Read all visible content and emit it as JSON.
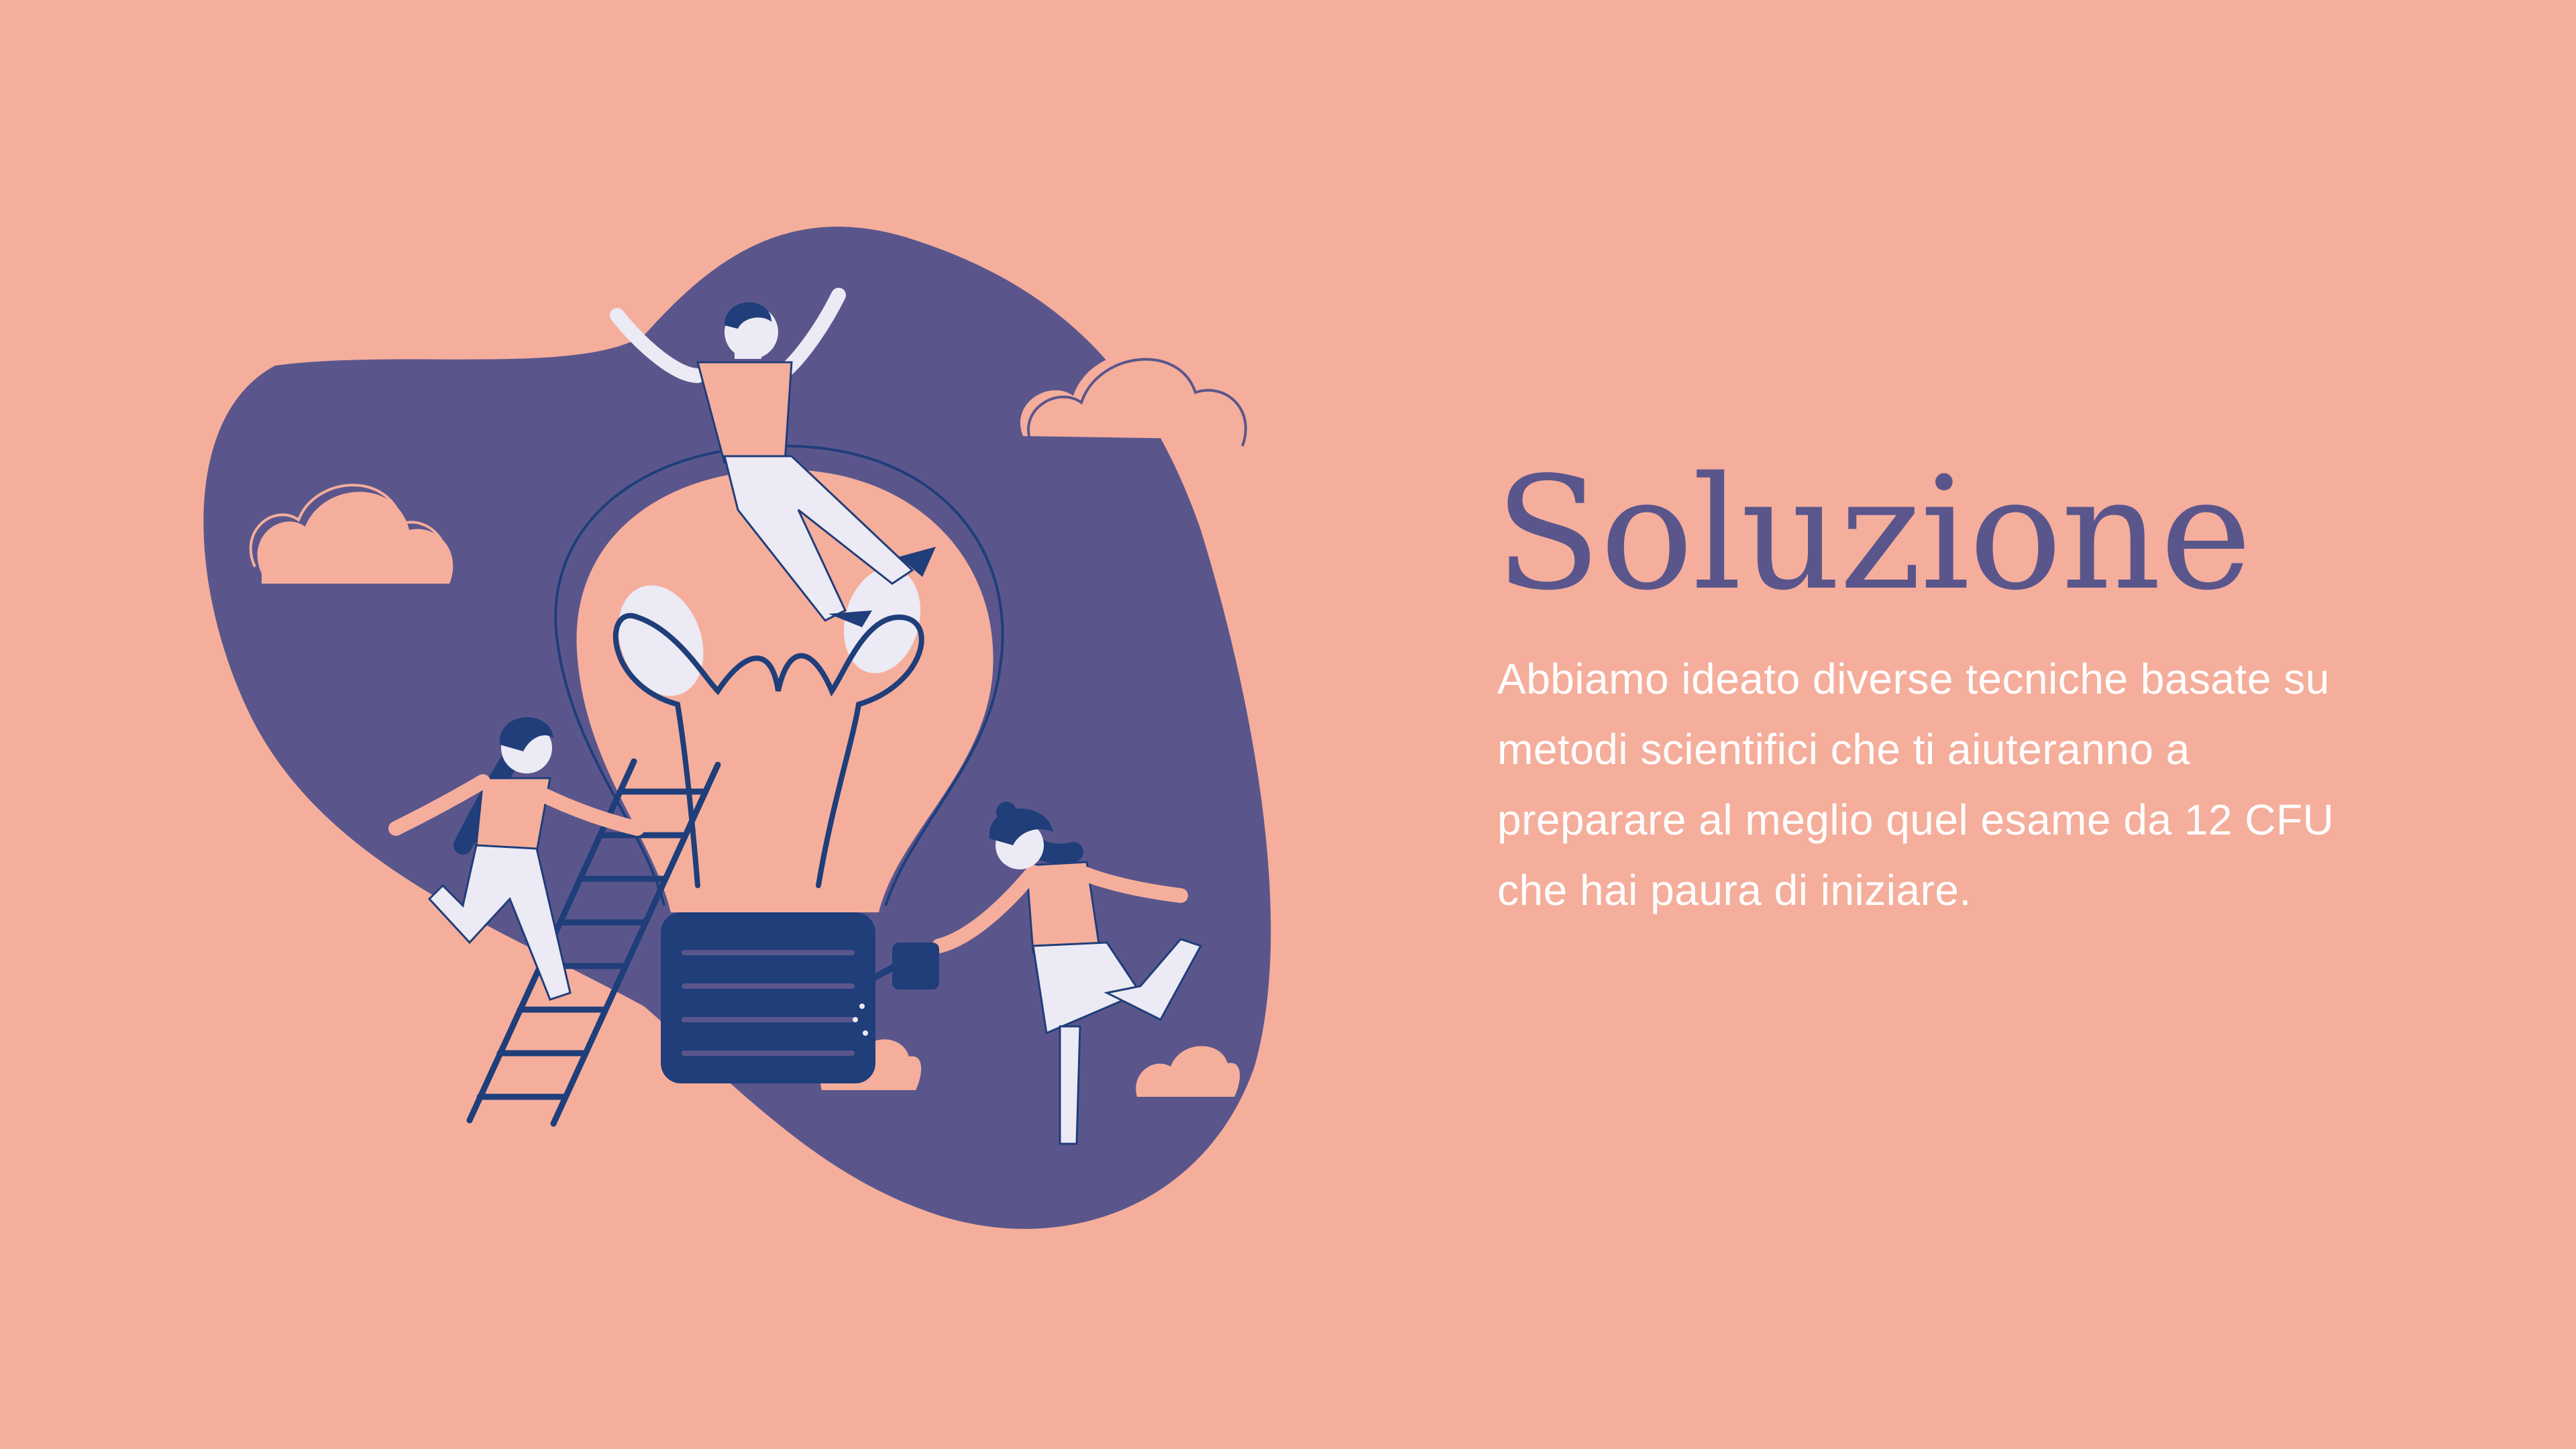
{
  "slide": {
    "title": "Soluzione",
    "body": "Abbiamo ideato diverse tecniche basate su metodi scientifici che ti aiuteranno a preparare al meglio quel esame da 12 CFU che hai paura di iniziare."
  },
  "illustration": {
    "subject": "people-around-lightbulb",
    "elements": [
      "blob-background",
      "lightbulb",
      "ladder",
      "clouds",
      "watering-can",
      "person-on-bulb",
      "person-climbing-ladder",
      "person-watering"
    ]
  },
  "colors": {
    "background": "#F5AE9C",
    "blob": "#5A568C",
    "navy": "#1F3E7A",
    "peach": "#F5AE9C",
    "white": "#FFFFFF",
    "light": "#ECEAF4"
  }
}
